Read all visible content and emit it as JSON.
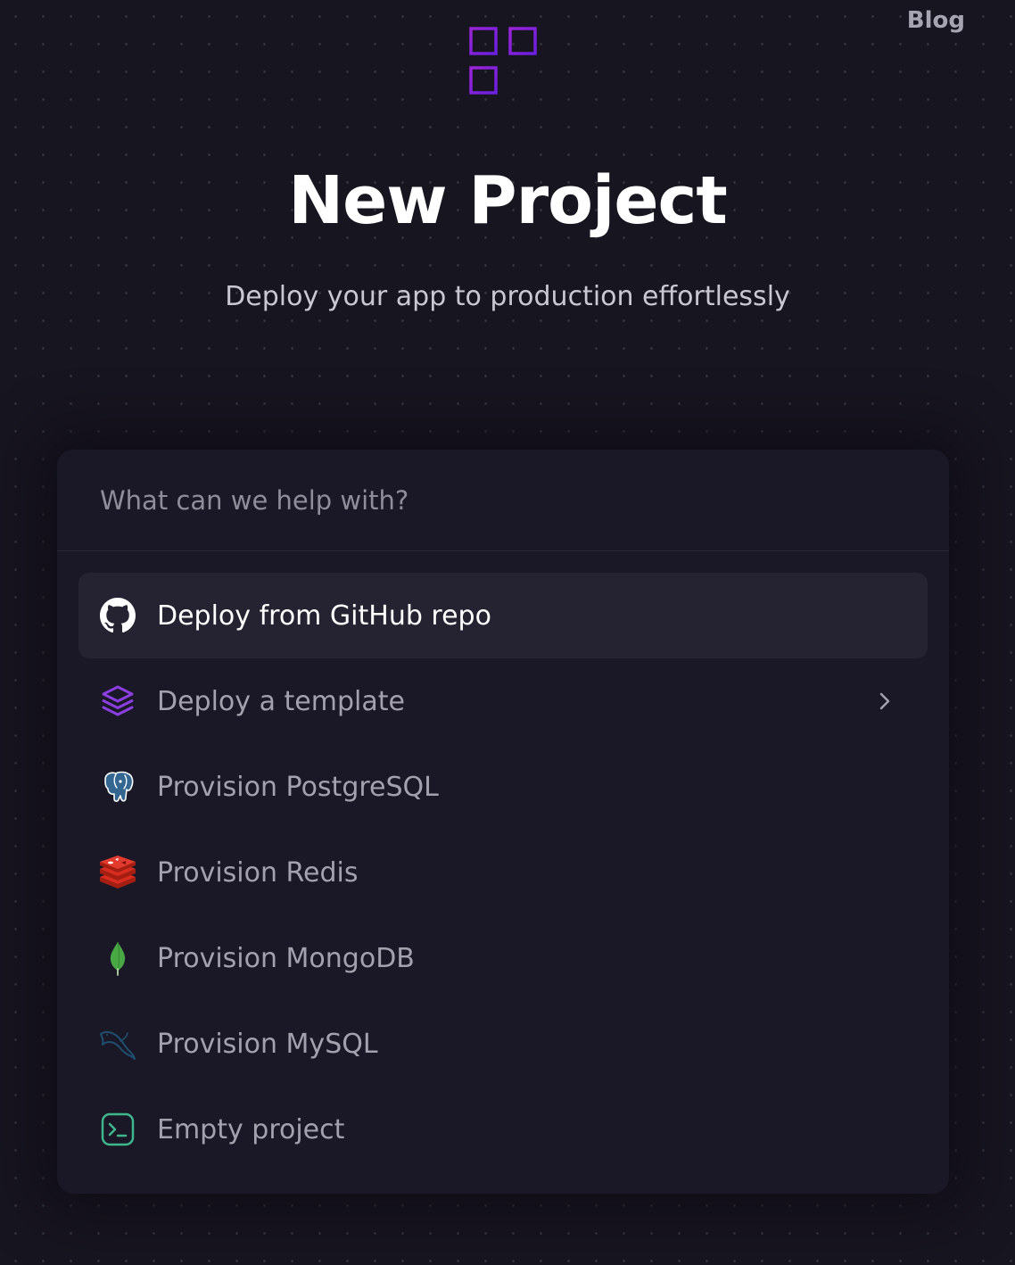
{
  "header": {
    "blog_label": "Blog"
  },
  "hero": {
    "title": "New Project",
    "subtitle": "Deploy your app to production effortlessly"
  },
  "search": {
    "placeholder": "What can we help with?",
    "value": ""
  },
  "menu": {
    "items": [
      {
        "label": "Deploy from GitHub repo",
        "icon": "github-icon",
        "active": true
      },
      {
        "label": "Deploy a template",
        "icon": "layers-icon",
        "has_submenu": true
      },
      {
        "label": "Provision PostgreSQL",
        "icon": "postgresql-icon"
      },
      {
        "label": "Provision Redis",
        "icon": "redis-icon"
      },
      {
        "label": "Provision MongoDB",
        "icon": "mongodb-icon"
      },
      {
        "label": "Provision MySQL",
        "icon": "mysql-icon"
      },
      {
        "label": "Empty project",
        "icon": "terminal-icon"
      }
    ]
  },
  "colors": {
    "background": "#17151f",
    "panel": "#1a1826",
    "active_row": "#252332",
    "logo_gradient_start": "#9a24d6",
    "logo_gradient_end": "#6b1fe0",
    "template_icon": "#8b3fe0",
    "terminal_icon": "#3fb68b",
    "mongodb_green": "#48a843",
    "redis_red": "#c8302a",
    "postgres_blue": "#336791",
    "mysql_blue": "#1f4f6e"
  }
}
